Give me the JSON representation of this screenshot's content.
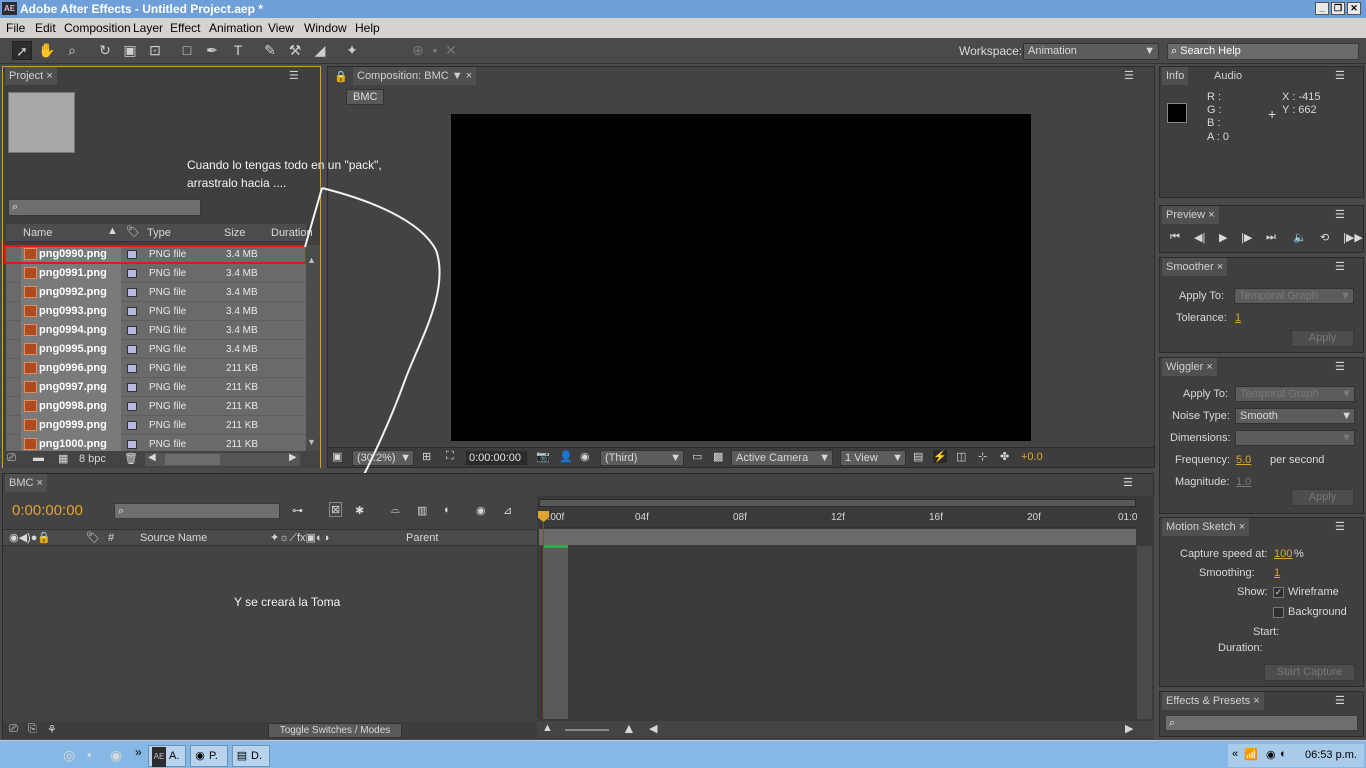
{
  "title_bar": {
    "app_icon": "AE",
    "title": "Adobe After Effects - Untitled Project.aep *",
    "buttons": [
      "minimize",
      "restore",
      "close"
    ]
  },
  "menu": [
    "File",
    "Edit",
    "Composition",
    "Layer",
    "Effect",
    "Animation",
    "View",
    "Window",
    "Help"
  ],
  "toolbar": {
    "tools": [
      "selection-tool",
      "hand-tool",
      "zoom-tool",
      "rotation-tool",
      "camera-tool",
      "pan-behind-tool",
      "rectangle-tool",
      "pen-tool",
      "type-tool",
      "brush-tool",
      "clone-stamp-tool",
      "eraser-tool",
      "puppet-tool"
    ],
    "workspace_label": "Workspace:",
    "workspace_value": "Animation",
    "search_placeholder": "Search Help"
  },
  "project": {
    "tab": "Project",
    "columns": [
      "Name",
      "Type",
      "Size",
      "Duration"
    ],
    "files": [
      {
        "name": "png0990.png",
        "type": "PNG file",
        "size": "3.4 MB"
      },
      {
        "name": "png0991.png",
        "type": "PNG file",
        "size": "3.4 MB"
      },
      {
        "name": "png0992.png",
        "type": "PNG file",
        "size": "3.4 MB"
      },
      {
        "name": "png0993.png",
        "type": "PNG file",
        "size": "3.4 MB"
      },
      {
        "name": "png0994.png",
        "type": "PNG file",
        "size": "3.4 MB"
      },
      {
        "name": "png0995.png",
        "type": "PNG file",
        "size": "3.4 MB"
      },
      {
        "name": "png0996.png",
        "type": "PNG file",
        "size": "211 KB"
      },
      {
        "name": "png0997.png",
        "type": "PNG file",
        "size": "211 KB"
      },
      {
        "name": "png0998.png",
        "type": "PNG file",
        "size": "211 KB"
      },
      {
        "name": "png0999.png",
        "type": "PNG file",
        "size": "211 KB"
      },
      {
        "name": "png1000.png",
        "type": "PNG file",
        "size": "211 KB"
      }
    ],
    "bpc": "8 bpc"
  },
  "composition": {
    "tab": "Composition: BMC",
    "breadcrumb": "BMC",
    "zoom": "(30.2%)",
    "timecode": "0:00:00:00",
    "resolution": "(Third)",
    "camera": "Active Camera",
    "views": "1 View",
    "exposure": "+0.0"
  },
  "annotations": {
    "top": "Cuando lo tengas todo en un \"pack\",",
    "top2": "arrastralo hacia ....",
    "bottom": "Y se creará la Toma"
  },
  "info": {
    "tabs": [
      "Info",
      "Audio"
    ],
    "r": "R :",
    "g": "G :",
    "b": "B :",
    "a": "A :  0",
    "x": "X : -415",
    "y": "Y : 662"
  },
  "preview": {
    "tab": "Preview"
  },
  "smoother": {
    "tab": "Smoother",
    "apply_to_label": "Apply To:",
    "apply_to_value": "Temporal Graph",
    "tolerance_label": "Tolerance:",
    "tolerance_value": "1",
    "apply": "Apply"
  },
  "wiggler": {
    "tab": "Wiggler",
    "apply_to_label": "Apply To:",
    "apply_to_value": "Temporal Graph",
    "noise_label": "Noise Type:",
    "noise_value": "Smooth",
    "dimensions_label": "Dimensions:",
    "frequency_label": "Frequency:",
    "frequency_value": "5.0",
    "frequency_unit": "per second",
    "magnitude_label": "Magnitude:",
    "magnitude_value": "1.0",
    "apply": "Apply"
  },
  "motion_sketch": {
    "tab": "Motion Sketch",
    "capture_label": "Capture speed at:",
    "capture_value": "100",
    "capture_unit": "%",
    "smoothing_label": "Smoothing:",
    "smoothing_value": "1",
    "show_label": "Show:",
    "wireframe": "Wireframe",
    "background": "Background",
    "start_label": "Start:",
    "duration_label": "Duration:",
    "start_capture": "Start Capture"
  },
  "effects": {
    "tab": "Effects & Presets"
  },
  "timeline": {
    "tab": "BMC",
    "timecode": "0:00:00:00",
    "columns": [
      "#",
      "Source Name",
      "Parent"
    ],
    "ruler": [
      "0:00f",
      "04f",
      "08f",
      "12f",
      "16f",
      "20f",
      "01:0"
    ],
    "toggle": "Toggle Switches / Modes"
  },
  "taskbar": {
    "buttons": [
      "A.",
      "P.",
      "D."
    ],
    "time": "06:53 p.m."
  }
}
